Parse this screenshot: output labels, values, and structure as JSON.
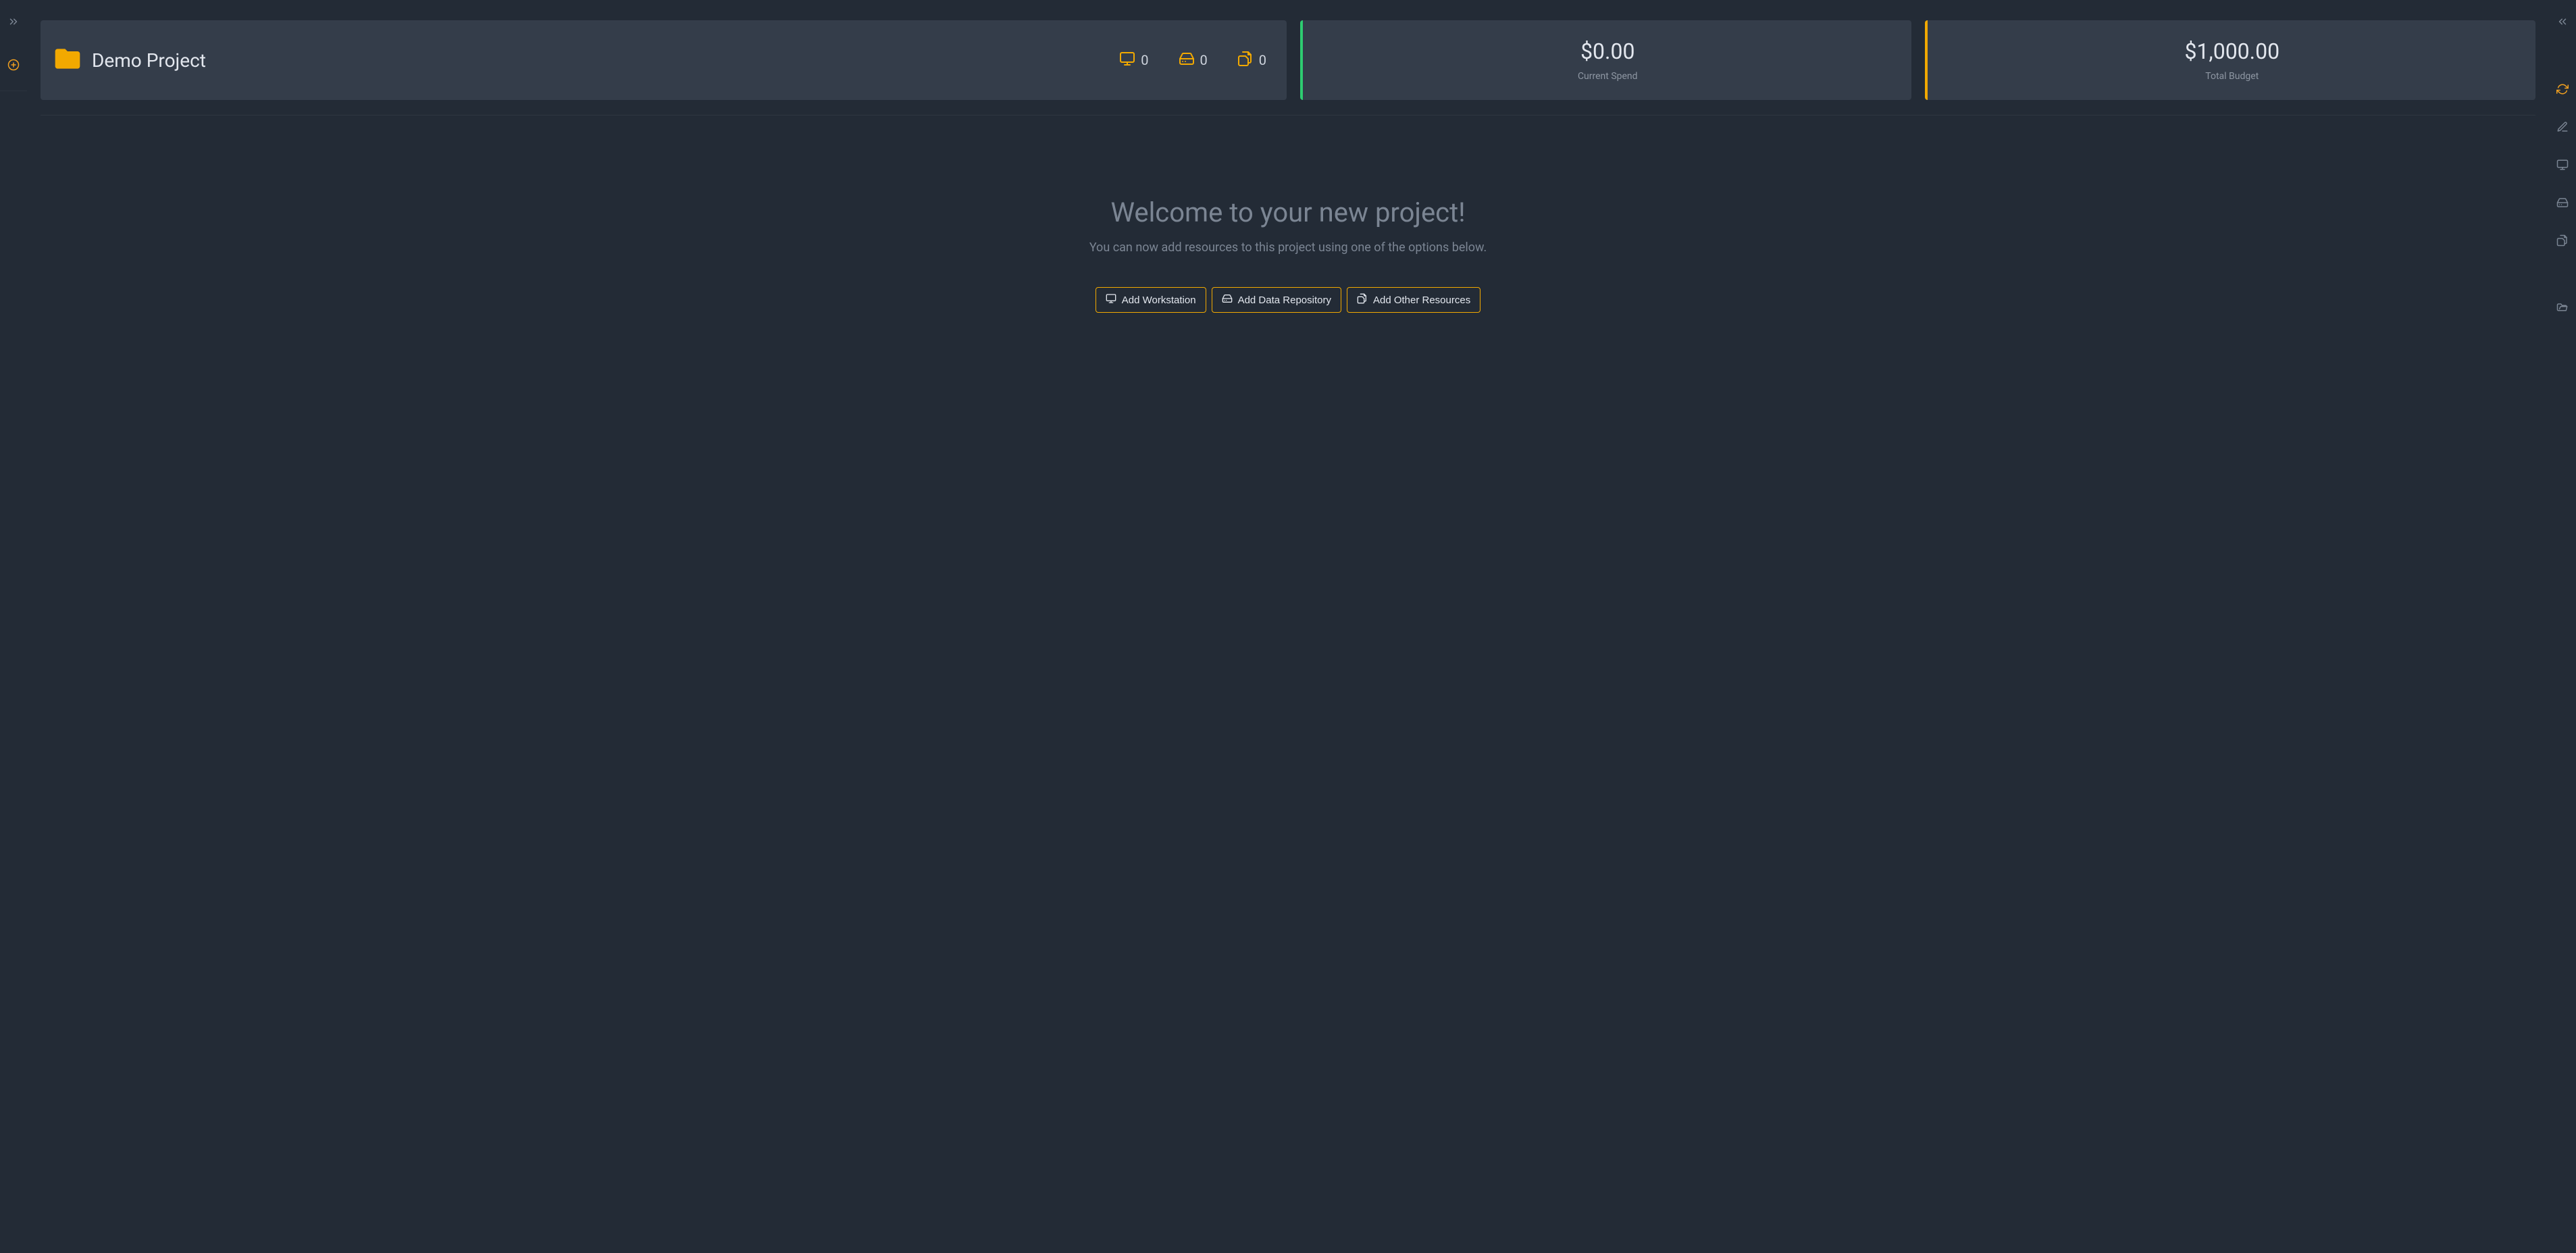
{
  "left_rail": {
    "expand_icon": "chevrons-right",
    "add_icon": "plus-circle"
  },
  "right_rail": {
    "collapse_icon": "chevrons-left",
    "refresh_icon": "refresh",
    "edit_icon": "pencil",
    "workstation_icon": "monitor",
    "repository_icon": "storage",
    "other_icon": "copy",
    "folder_icon": "folder-open"
  },
  "project": {
    "title": "Demo Project",
    "stats": {
      "workstations": "0",
      "repositories": "0",
      "other": "0"
    }
  },
  "kpi": {
    "spend_value": "$0.00",
    "spend_label": "Current Spend",
    "budget_value": "$1,000.00",
    "budget_label": "Total Budget"
  },
  "welcome": {
    "heading": "Welcome to your new project!",
    "subheading": "You can now add resources to this project using one of the options below.",
    "add_workstation_label": "Add Workstation",
    "add_repository_label": "Add Data Repository",
    "add_other_label": "Add Other Resources"
  },
  "colors": {
    "accent": "#f2a900",
    "green": "#2ecc71",
    "bg": "#232b36",
    "card": "#343d4a"
  }
}
